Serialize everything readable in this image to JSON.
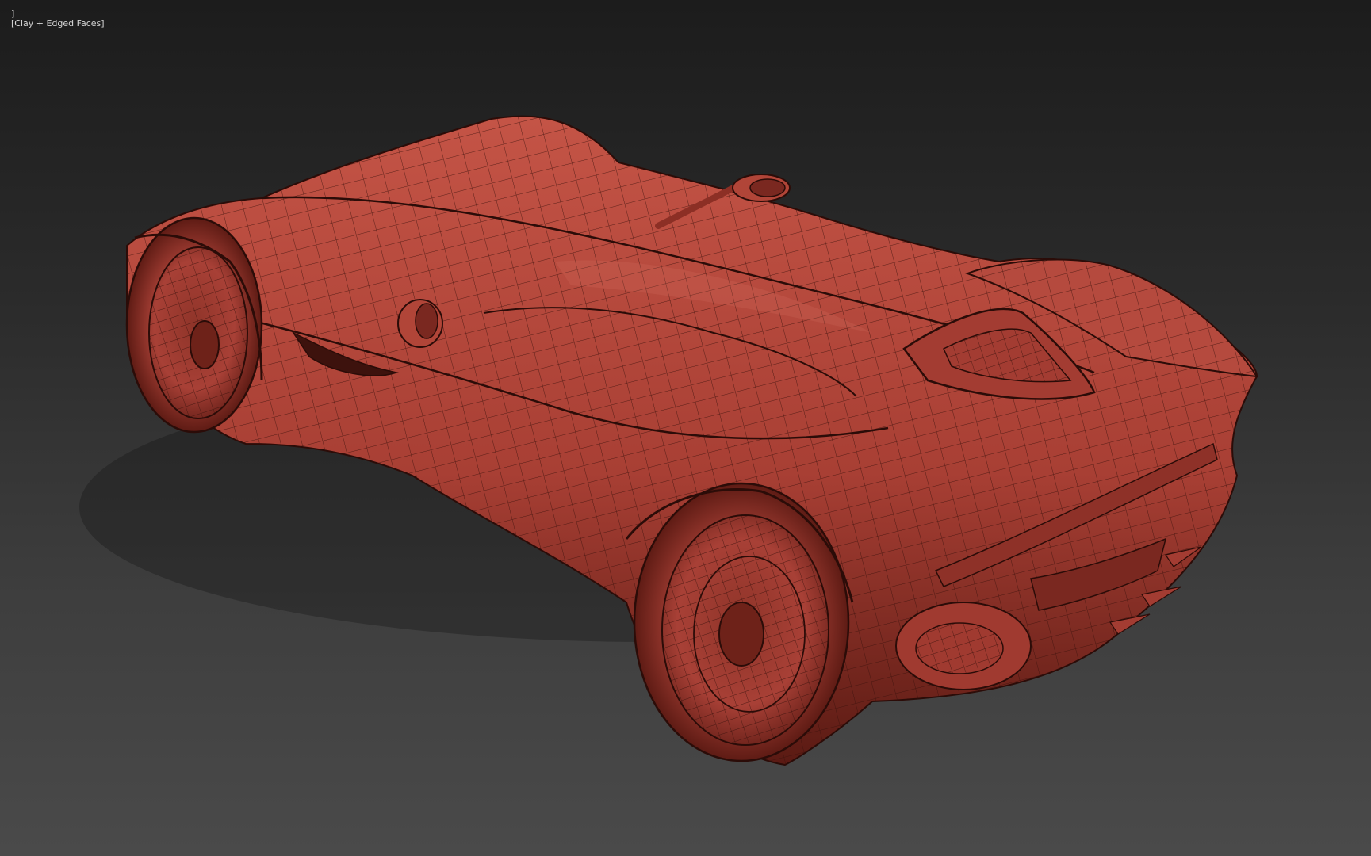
{
  "viewport": {
    "label_prefix": "]",
    "label_shading": "[Clay + Edged Faces]",
    "background_top": "#1c1c1c",
    "background_bottom": "#4a4a4a"
  },
  "model": {
    "base_color": "#b5483d",
    "edge_color": "#2b0c08",
    "description_icon": "car-model-icon"
  }
}
